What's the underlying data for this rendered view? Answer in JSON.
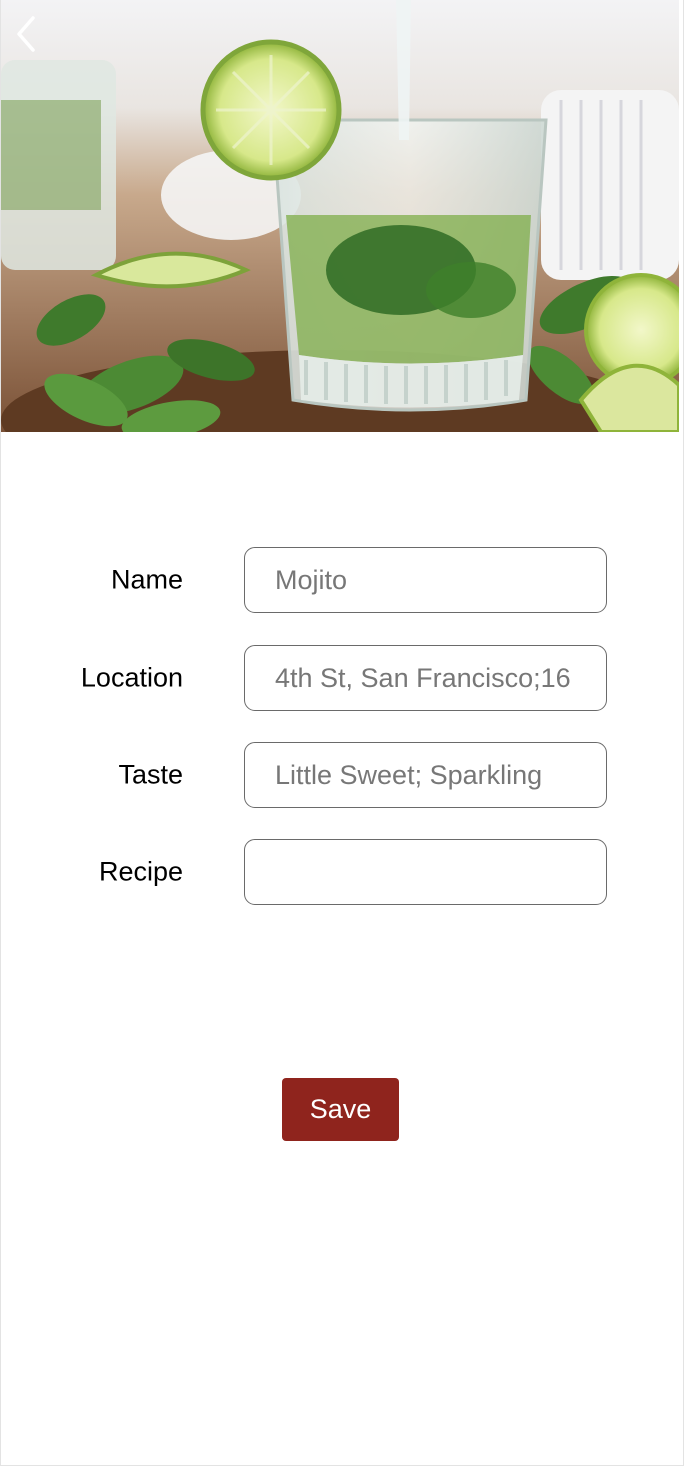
{
  "header": {
    "back_icon": "chevron-left-icon",
    "hero_image": "mojito-glass-photo"
  },
  "form": {
    "fields": [
      {
        "label": "Name",
        "value": "Mojito",
        "placeholder": ""
      },
      {
        "label": "Location",
        "value": "4th St, San Francisco;16",
        "placeholder": ""
      },
      {
        "label": "Taste",
        "value": "Little Sweet; Sparkling",
        "placeholder": ""
      },
      {
        "label": "Recipe",
        "value": "",
        "placeholder": ""
      }
    ],
    "save_label": "Save"
  },
  "colors": {
    "save_button": "#8f241d",
    "input_border": "#6a6a6a",
    "input_text": "#777777"
  }
}
